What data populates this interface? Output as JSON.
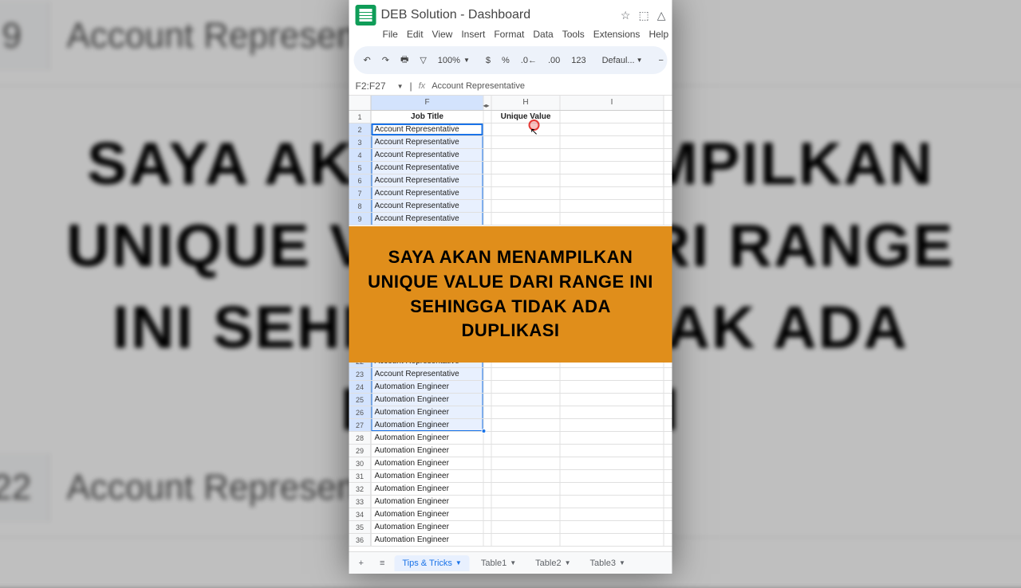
{
  "background": {
    "rows": [
      {
        "num": "9",
        "text": "Account Representative"
      },
      {
        "num": "22",
        "text": "Account Representative"
      }
    ],
    "text": [
      "SAYA AKAN MENAMPILKAN",
      "UNIQUE VALUE DARI RANGE",
      "INI SEHINGGA TIDAK ADA",
      "DUPLIKASI"
    ]
  },
  "doc_title": "DEB Solution - Dashboard",
  "menu": [
    "File",
    "Edit",
    "View",
    "Insert",
    "Format",
    "Data",
    "Tools",
    "Extensions",
    "Help"
  ],
  "toolbar": {
    "zoom": "100%",
    "font": "Defaul..."
  },
  "namebox": "F2:F27",
  "formula": "Account Representative",
  "columns": {
    "f": "F",
    "g": "",
    "h": "H",
    "i": "I"
  },
  "header_row": {
    "f": "Job Title",
    "h": "Unique Value"
  },
  "rows_top": [
    {
      "n": "1"
    },
    {
      "n": "2",
      "f": "Account Representative",
      "active": true
    },
    {
      "n": "3",
      "f": "Account Representative"
    },
    {
      "n": "4",
      "f": "Account Representative"
    },
    {
      "n": "5",
      "f": "Account Representative"
    },
    {
      "n": "6",
      "f": "Account Representative"
    },
    {
      "n": "7",
      "f": "Account Representative"
    },
    {
      "n": "8",
      "f": "Account Representative"
    },
    {
      "n": "9",
      "f": "Account Representative"
    }
  ],
  "rows_bottom": [
    {
      "n": "22",
      "f": "Account Representative"
    },
    {
      "n": "23",
      "f": "Account Representative"
    },
    {
      "n": "24",
      "f": "Automation Engineer"
    },
    {
      "n": "25",
      "f": "Automation Engineer"
    },
    {
      "n": "26",
      "f": "Automation Engineer"
    },
    {
      "n": "27",
      "f": "Automation Engineer",
      "last_sel": true
    },
    {
      "n": "28",
      "f": "Automation Engineer"
    },
    {
      "n": "29",
      "f": "Automation Engineer"
    },
    {
      "n": "30",
      "f": "Automation Engineer"
    },
    {
      "n": "31",
      "f": "Automation Engineer"
    },
    {
      "n": "32",
      "f": "Automation Engineer"
    },
    {
      "n": "33",
      "f": "Automation Engineer"
    },
    {
      "n": "34",
      "f": "Automation Engineer"
    },
    {
      "n": "35",
      "f": "Automation Engineer"
    },
    {
      "n": "36",
      "f": "Automation Engineer"
    }
  ],
  "caption": "SAYA AKAN MENAMPILKAN UNIQUE VALUE DARI RANGE INI SEHINGGA TIDAK ADA DUPLIKASI",
  "tabs": {
    "add": "+",
    "menu": "≡",
    "items": [
      {
        "name": "Tips & Tricks",
        "active": true
      },
      {
        "name": "Table1"
      },
      {
        "name": "Table2"
      },
      {
        "name": "Table3"
      }
    ]
  }
}
